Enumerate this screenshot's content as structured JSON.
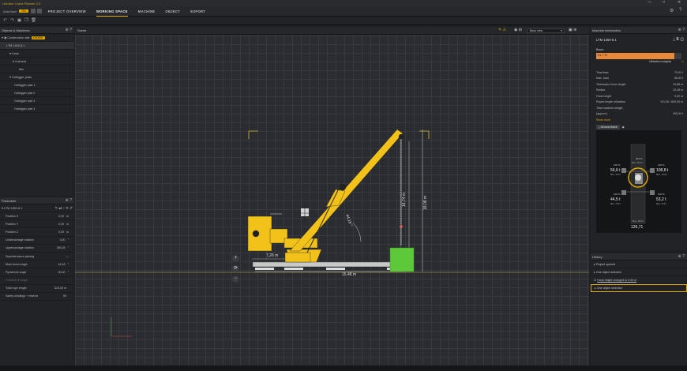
{
  "app": {
    "title": "Liebherr Crane Planner 2.0",
    "autosave_label": "AutoSave",
    "autosave_state": "ON"
  },
  "menu": [
    "PROJECT OVERVIEW",
    "WORKING SPACE",
    "MACHINE",
    "OBJECT",
    "EXPORT"
  ],
  "objects_panel": {
    "title": "Objects & Machines",
    "site": "Construction site",
    "site_badge": "KEEPER",
    "crane": "LTM 1450-8.1",
    "items": [
      "Hook",
      "4-strand",
      "Ibis",
      "Outrigger pads",
      "Outrigger pad 1",
      "Outrigger pad 2",
      "Outrigger pad 3",
      "Outrigger pad 4"
    ]
  },
  "parameter_panel": {
    "title": "Parameter",
    "crane": "LTM 1450-8.1",
    "rows": [
      {
        "label": "Position X",
        "value": "0,00",
        "unit": "m"
      },
      {
        "label": "Position Y",
        "value": "0,00",
        "unit": "m"
      },
      {
        "label": "Position Z",
        "value": "0,00",
        "unit": "m"
      },
      {
        "label": "Undercarriage rotation",
        "value": "0,00",
        "unit": "°"
      },
      {
        "label": "Uppercarriage rotation",
        "value": "269,26",
        "unit": "°"
      },
      {
        "label": "Superstructure pinning",
        "value": "",
        "unit": "—"
      },
      {
        "label": "Main boom angle",
        "value": "44,18",
        "unit": "°"
      },
      {
        "label": "Fly/derrick angle",
        "value": "00,00",
        "unit": "°"
      },
      {
        "label": "Foldable jib angle",
        "value": "",
        "unit": "°"
      },
      {
        "label": "Total rope length",
        "value": "520,00 m",
        "unit": ""
      },
      {
        "label": "Safety windings + reserve",
        "value": "59",
        "unit": ""
      }
    ]
  },
  "scene": {
    "title": "Scene",
    "view": "Back view",
    "dims": {
      "height_a": "16,74 m",
      "height_b": "18,08 m",
      "radius": "7,26 m",
      "width": "15,48 m",
      "angle": "44,18 °"
    }
  },
  "machine_info": {
    "title": "Machine information",
    "name": "LTM 1450-8.1",
    "section": "Boom",
    "utilization_pct": "91,7 %",
    "utilization_fraction": 0.917,
    "utilization_note": "Utilization marginal",
    "rows": [
      {
        "label": "Total load",
        "value": "79,01 t"
      },
      {
        "label": "Max. load",
        "value": "86,93 t"
      },
      {
        "label": "Telescopic boom length",
        "value": "19,88 m"
      },
      {
        "label": "Radius",
        "value": "15,48 m"
      },
      {
        "label": "Hook height",
        "value": "9,00 m"
      },
      {
        "label": "Ropes length utilization",
        "value": "101,06 / 840,00 m"
      },
      {
        "label": "Total machine weight",
        "value": ""
      },
      {
        "label": "(approx.)",
        "value": "290,04 t"
      }
    ],
    "show_more": "Show more",
    "ground_tab": "Ground force",
    "forces": {
      "tl_pct": "100 %",
      "tl": "56,6 t",
      "tl_sub": "Max. 75,8 t",
      "tr_pct": "100 %",
      "tr": "108,8 t",
      "tr_sub": "Max. 175,8 t",
      "bl_pct": "100 %",
      "bl": "44,5 t",
      "bl_sub": "Max. 75,8 t",
      "br_pct": "100 %",
      "br": "53,2 t",
      "br_sub": "Max. 75,8 t",
      "top_pct": "344 %",
      "top": "Max. 100,0 t",
      "bottom_sub": "Max. 166,8 t",
      "bottom": "126,71"
    }
  },
  "history": {
    "title": "History",
    "rows": [
      "Project opened",
      "One object selected",
      "Hook height changed to 9,00 m",
      "One object selected"
    ]
  },
  "colors": {
    "accent": "#e0a800",
    "crane": "#f2c21b",
    "load": "#5ec83b",
    "warn": "#e8893a"
  }
}
